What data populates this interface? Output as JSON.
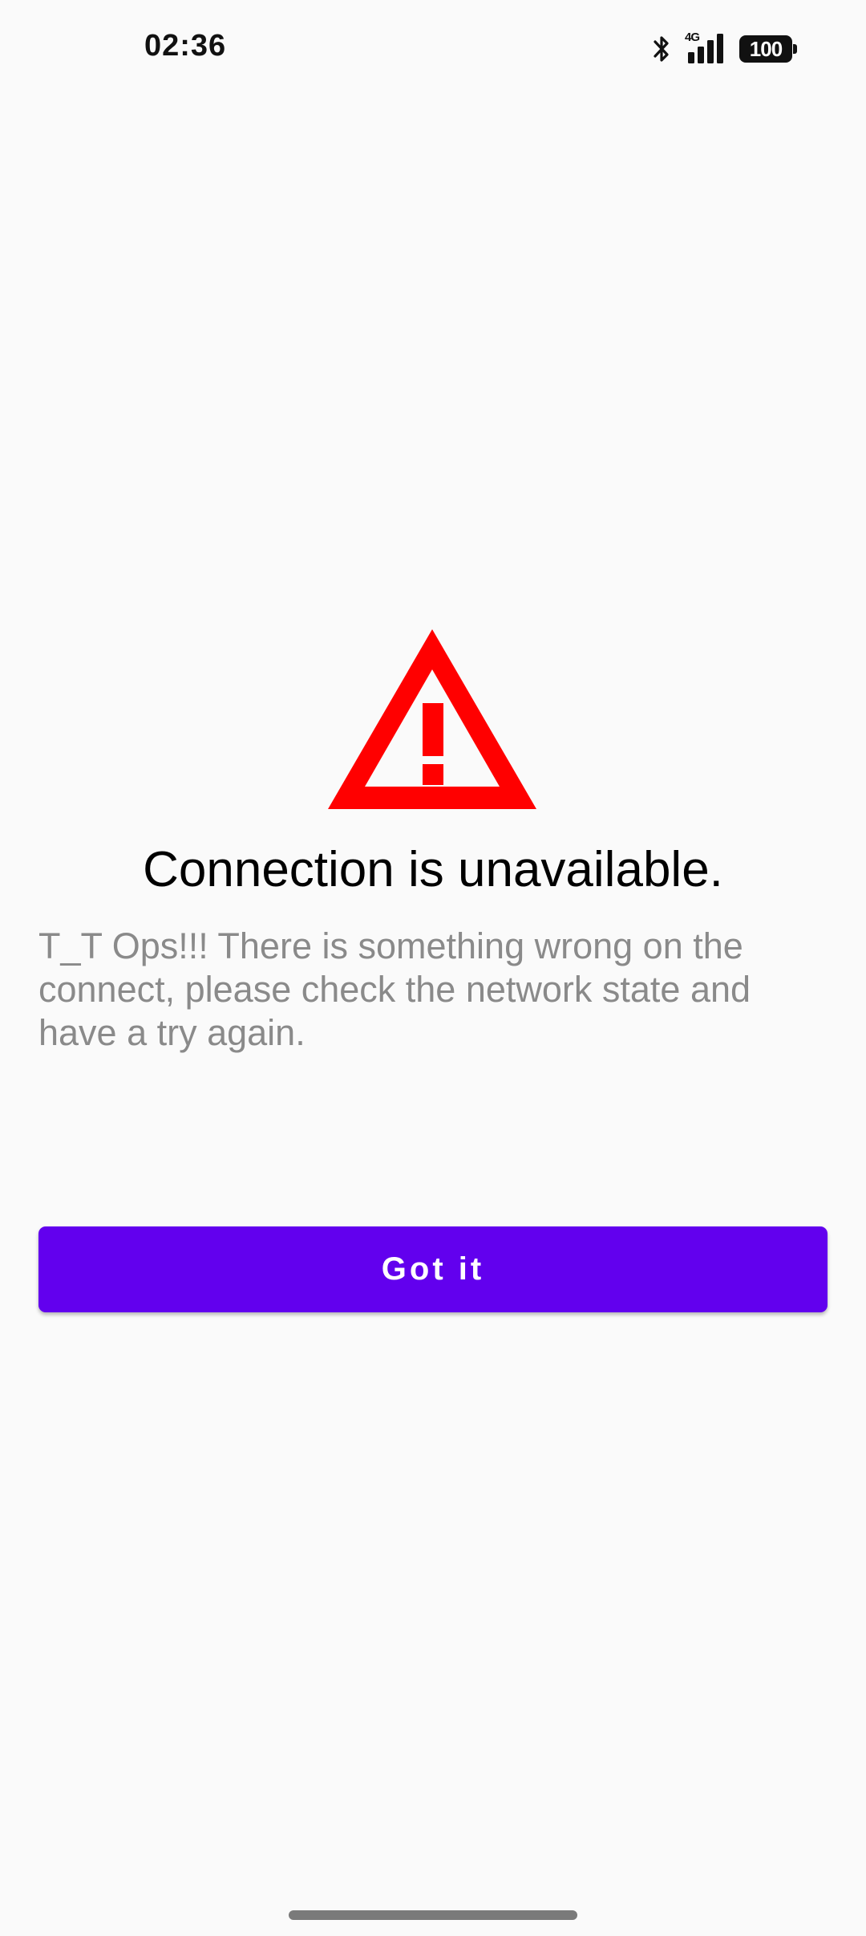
{
  "status_bar": {
    "time": "02:36",
    "network_label": "4G",
    "battery_level": "100",
    "icons": [
      "bluetooth-icon",
      "signal-4g-icon",
      "battery-icon"
    ]
  },
  "dialog": {
    "icon": "warning-triangle-icon",
    "icon_color": "#ff0000",
    "title": "Connection is unavailable.",
    "message": "T_T Ops!!! There is something wrong on the connect, please check the network state and have a try again.",
    "button_label": "Got it"
  },
  "colors": {
    "background": "#fafafa",
    "accent": "#6200ee",
    "message_text": "#8a8a8a"
  }
}
